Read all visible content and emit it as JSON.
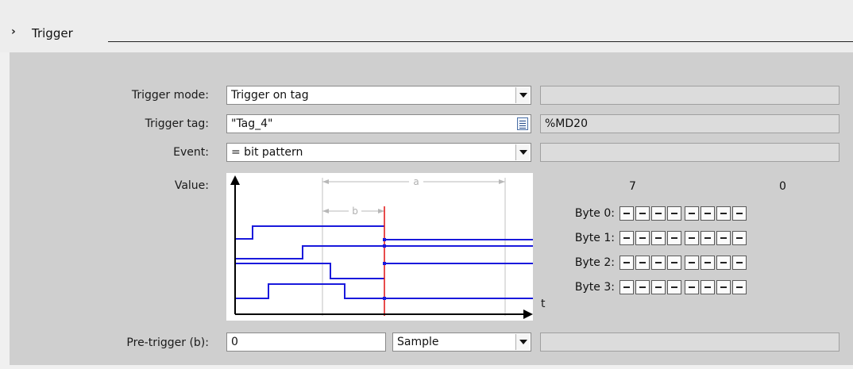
{
  "section": {
    "title": "Trigger",
    "expand_icon": "chevron-right-icon"
  },
  "trigger_mode": {
    "label": "Trigger mode:",
    "value": "Trigger on tag"
  },
  "trigger_tag": {
    "label": "Trigger tag:",
    "value": "\"Tag_4\"",
    "address": "%MD20"
  },
  "event": {
    "label": "Event:",
    "value": "= bit pattern"
  },
  "value": {
    "label": "Value:",
    "diagram": {
      "interval_a": "a",
      "interval_b": "b",
      "axis_t": "t"
    },
    "bit_high_label": "7",
    "bit_low_label": "0",
    "bytes": [
      {
        "label": "Byte 0:",
        "bits": [
          "-",
          "-",
          "-",
          "-",
          "-",
          "-",
          "-",
          "-"
        ]
      },
      {
        "label": "Byte 1:",
        "bits": [
          "-",
          "-",
          "-",
          "-",
          "-",
          "-",
          "-",
          "-"
        ]
      },
      {
        "label": "Byte 2:",
        "bits": [
          "-",
          "-",
          "-",
          "-",
          "-",
          "-",
          "-",
          "-"
        ]
      },
      {
        "label": "Byte 3:",
        "bits": [
          "-",
          "-",
          "-",
          "-",
          "-",
          "-",
          "-",
          "-"
        ]
      }
    ]
  },
  "pre_trigger": {
    "label": "Pre-trigger (b):",
    "value": "0",
    "unit": "Sample"
  },
  "colors": {
    "signal": "#1a1adc",
    "trigger_line": "#e01010",
    "panel": "#cfcfcf"
  }
}
